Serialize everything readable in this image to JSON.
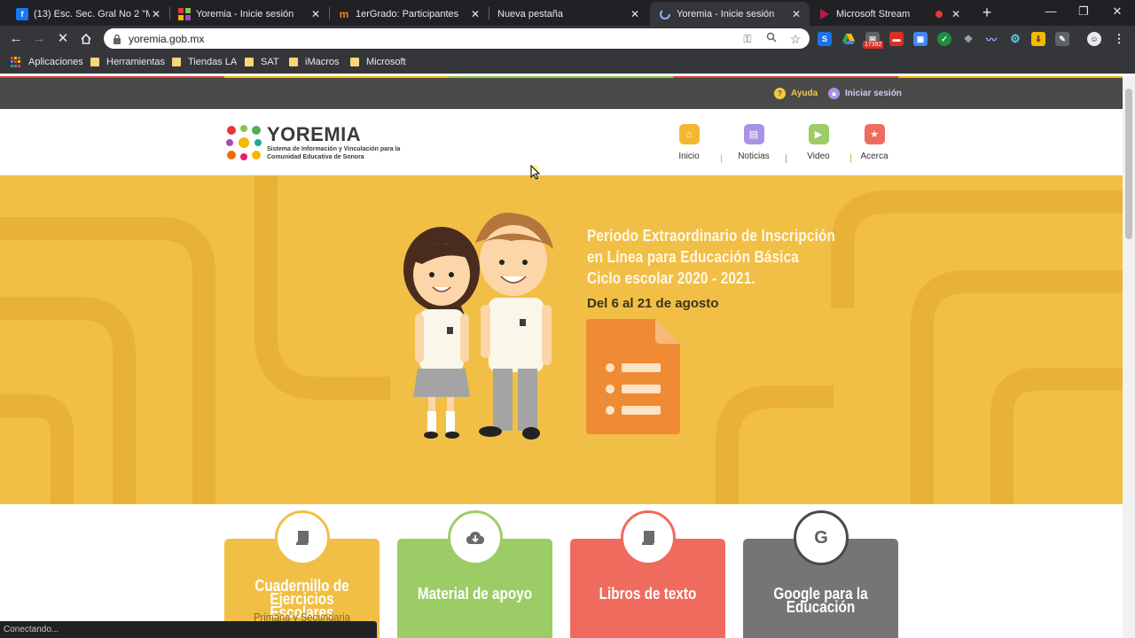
{
  "tabs": [
    {
      "title": "(13) Esc. Sec. Gral No 2 \"Moi",
      "favicon": "facebook-icon",
      "active": false
    },
    {
      "title": "Yoremia - Inicie sesión",
      "favicon": "yoremia-icon",
      "active": false
    },
    {
      "title": "1erGrado: Participantes",
      "favicon": "moodle-icon",
      "active": false
    },
    {
      "title": "Nueva pestaña",
      "favicon": "",
      "active": false
    },
    {
      "title": "Yoremia - Inicie sesión",
      "favicon": "loading-icon",
      "active": true
    },
    {
      "title": "Microsoft Stream",
      "favicon": "stream-icon",
      "active": false
    }
  ],
  "address_bar": {
    "url": "yoremia.gob.mx"
  },
  "extension_badge": "17392",
  "bookmarks": [
    {
      "label": "Aplicaciones",
      "icon": "apps-icon"
    },
    {
      "label": "Herramientas",
      "icon": "folder-icon"
    },
    {
      "label": "Tiendas LA",
      "icon": "folder-icon"
    },
    {
      "label": "SAT",
      "icon": "folder-icon"
    },
    {
      "label": "iMacros",
      "icon": "folder-icon"
    },
    {
      "label": "Microsoft",
      "icon": "folder-icon"
    }
  ],
  "site": {
    "top_links": {
      "help": "Ayuda",
      "login": "Iniciar sesión"
    },
    "logo": {
      "brand": "YOREMIA",
      "tagline": "Sistema de Información y Vinculación para la Comunidad Educativa de Sonora"
    },
    "nav": [
      {
        "label": "Inicio",
        "icon": "home-icon",
        "color": "#f5b731"
      },
      {
        "label": "Noticias",
        "icon": "news-icon",
        "color": "#a993e6"
      },
      {
        "label": "Video",
        "icon": "video-icon",
        "color": "#9ccc65"
      },
      {
        "label": "Acerca",
        "icon": "star-icon",
        "color": "#ef6b5e"
      }
    ],
    "hero": {
      "title_lines": [
        "Periodo Extraordinario de Inscripción",
        "en Línea para Educación Básica",
        "Ciclo escolar 2020 - 2021."
      ],
      "dates": "Del 6 al 21 de agosto",
      "background": "#f1bf45"
    },
    "cards": [
      {
        "title": "Cuadernillo de Ejercicios Escolares",
        "subtitle": "Primaria y Secundaria",
        "icon": "book-icon",
        "color": "#f1bf45"
      },
      {
        "title": "Material de apoyo",
        "subtitle": "",
        "icon": "cloud-download-icon",
        "color": "#9ccc65"
      },
      {
        "title": "Libros de texto",
        "subtitle": "",
        "icon": "book-icon",
        "color": "#ef6b5e"
      },
      {
        "title": "Google para la Educación",
        "subtitle": "",
        "icon": "google-icon",
        "color": "#757575"
      }
    ]
  },
  "status_text": "Conectando..."
}
